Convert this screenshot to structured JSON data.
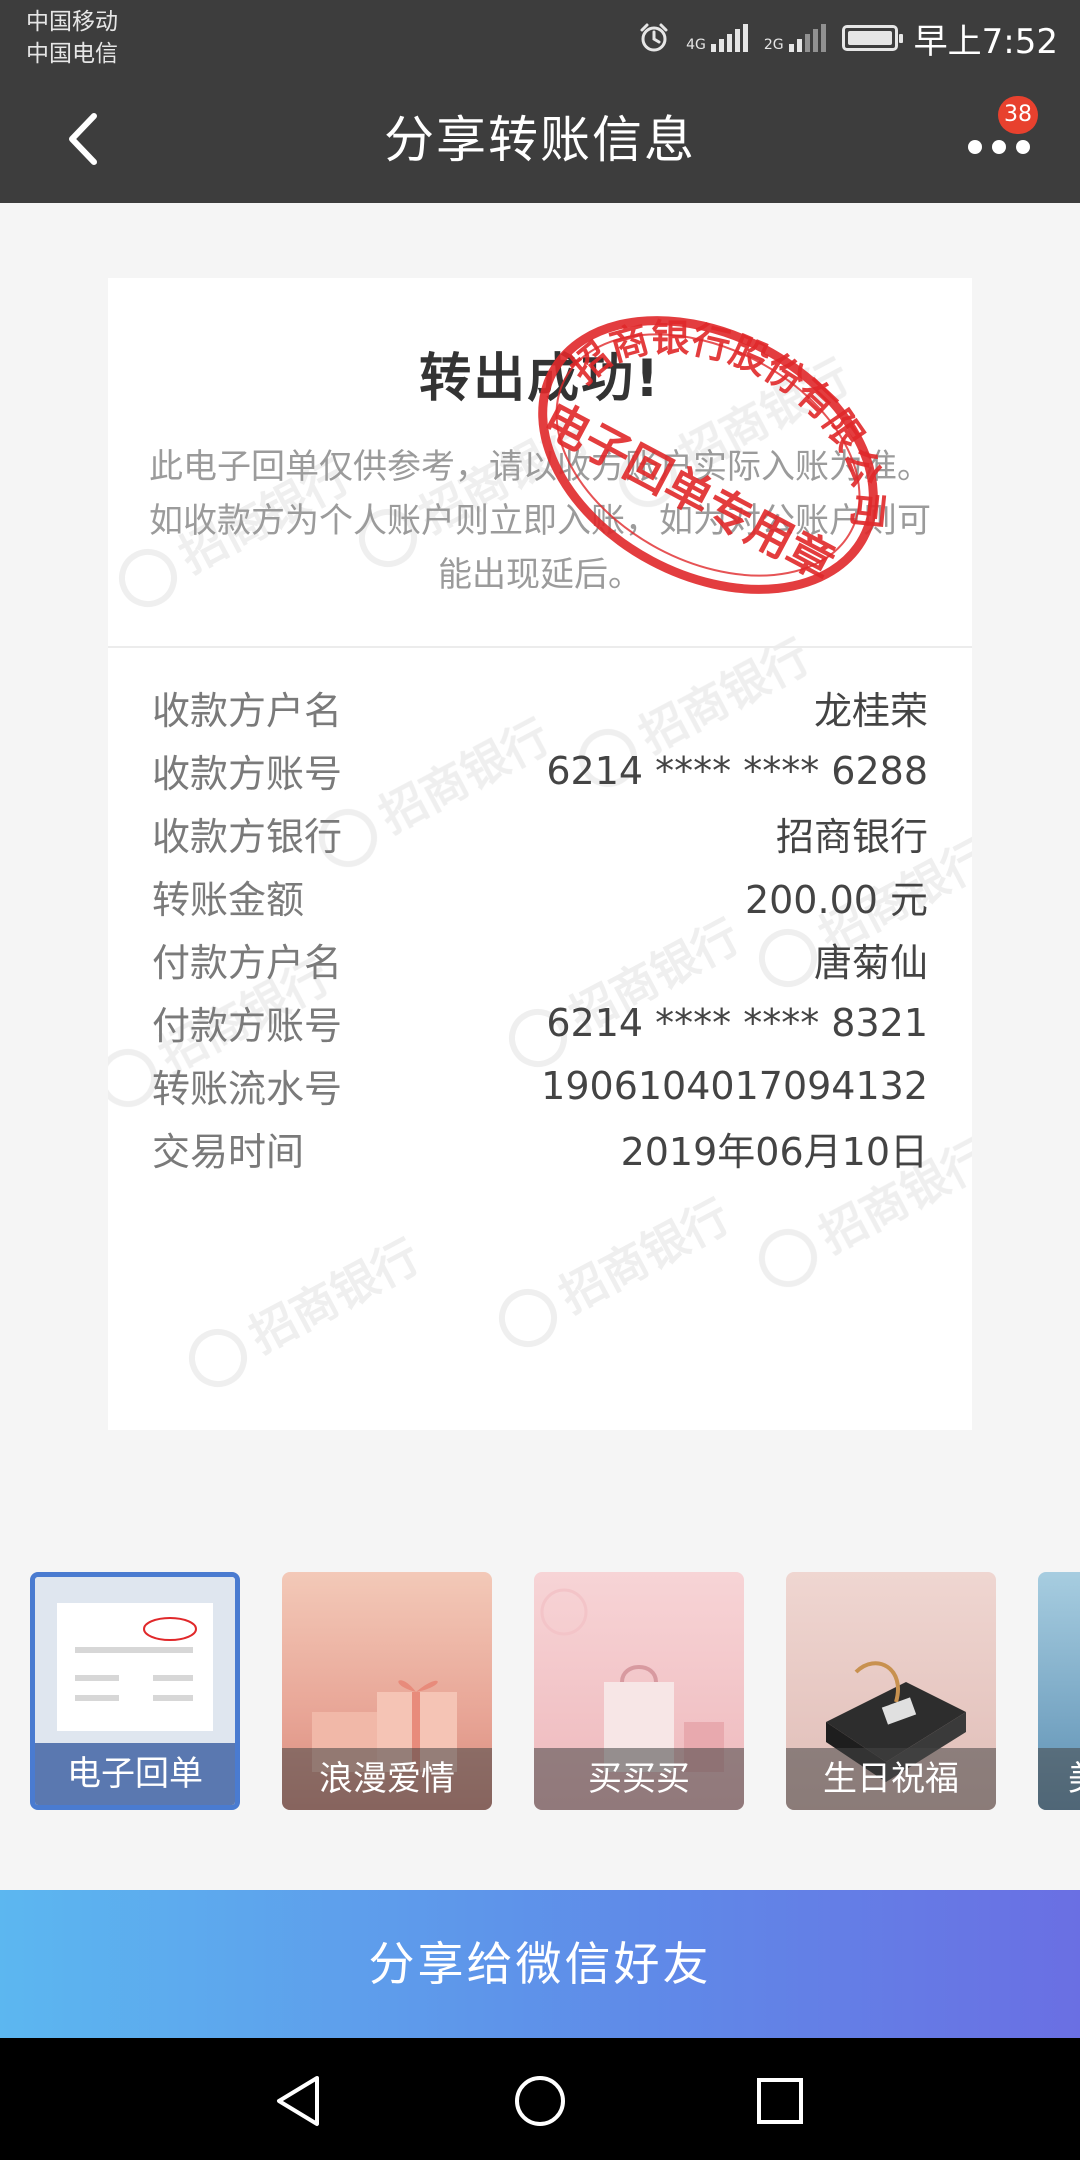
{
  "status_bar": {
    "carrier_1": "中国移动",
    "carrier_2": "中国电信",
    "net_1": "4G",
    "net_2": "2G",
    "time": "早上7:52"
  },
  "header": {
    "title": "分享转账信息",
    "badge_count": "38"
  },
  "receipt": {
    "title": "转出成功!",
    "note": "此电子回单仅供参考，请以收方账户实际入账为准。如收款方为个人账户则立即入账，如为对公账户则可能出现延后。",
    "stamp_text_outer": "招商银行股份有限公司",
    "stamp_text_inner": "电子回单专用章",
    "watermark_text": "招商银行",
    "details": [
      {
        "label": "收款方户名",
        "value": "龙桂荣"
      },
      {
        "label": "收款方账号",
        "value": "6214 **** **** 6288"
      },
      {
        "label": "收款方银行",
        "value": "招商银行"
      },
      {
        "label": "转账金额",
        "value": "200.00 元"
      },
      {
        "label": "付款方户名",
        "value": "唐菊仙"
      },
      {
        "label": "付款方账号",
        "value": "6214 **** **** 8321"
      },
      {
        "label": "转账流水号",
        "value": "1906104017094132"
      },
      {
        "label": "交易时间",
        "value": "2019年06月10日"
      }
    ]
  },
  "themes": [
    {
      "label": "电子回单",
      "selected": true
    },
    {
      "label": "浪漫爱情",
      "selected": false
    },
    {
      "label": "买买买",
      "selected": false
    },
    {
      "label": "生日祝福",
      "selected": false
    },
    {
      "label": "美",
      "selected": false
    }
  ],
  "share_button": {
    "label": "分享给微信好友"
  },
  "colors": {
    "header_bg": "#3d3d3d",
    "stamp_red": "#e0282a",
    "badge_red": "#e8412e",
    "selected_border": "#4a7bd0"
  }
}
